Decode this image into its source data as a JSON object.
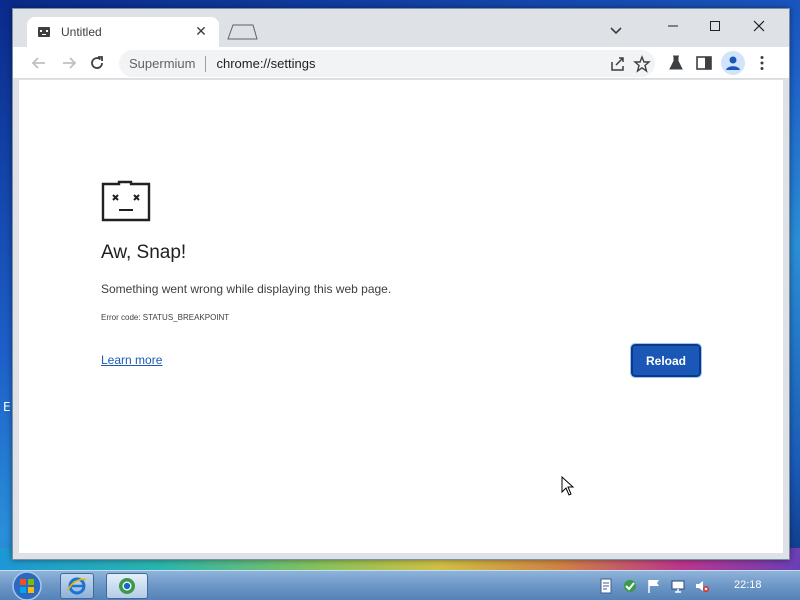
{
  "browser": {
    "tab": {
      "title": "Untitled"
    },
    "omnibox": {
      "site_name": "Supermium",
      "url": "chrome://settings"
    }
  },
  "page": {
    "error_title": "Aw, Snap!",
    "error_message": "Something went wrong while displaying this web page.",
    "error_code": "Error code: STATUS_BREAKPOINT",
    "learn_more_label": "Learn more",
    "reload_label": "Reload"
  },
  "taskbar": {
    "clock": "22:18"
  },
  "desktop": {
    "edge_letter": "E"
  },
  "colors": {
    "reload_button": "#1a57b6",
    "link": "#1a5bb6",
    "tab_strip": "#dee1e6"
  }
}
